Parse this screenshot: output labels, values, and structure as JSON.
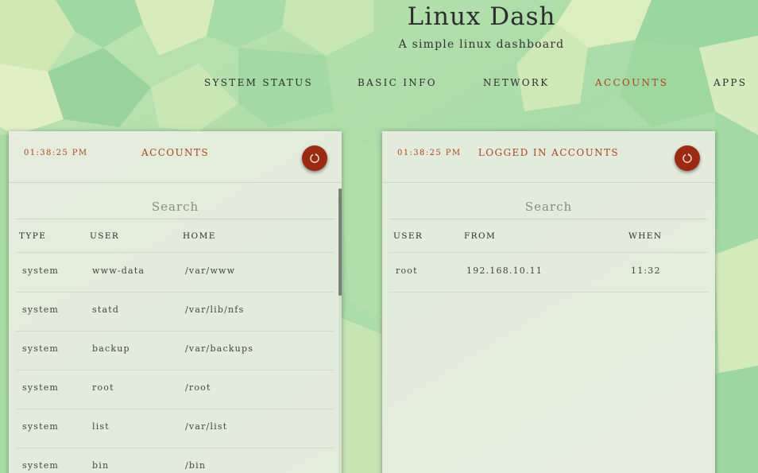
{
  "app": {
    "title": "Linux Dash",
    "subtitle": "A simple linux dashboard"
  },
  "nav": {
    "items": [
      "SYSTEM STATUS",
      "BASIC INFO",
      "NETWORK",
      "ACCOUNTS",
      "APPS"
    ],
    "active": "ACCOUNTS"
  },
  "colors": {
    "accent": "#a8461e",
    "button": "#9b2a12",
    "panel": "#eceee4"
  },
  "accounts_panel": {
    "time": "01:38:25 PM",
    "title": "ACCOUNTS",
    "refresh_icon": "refresh-icon",
    "search_placeholder": "Search",
    "columns": [
      "TYPE",
      "USER",
      "HOME"
    ],
    "rows": [
      [
        "system",
        "www-data",
        "/var/www"
      ],
      [
        "system",
        "statd",
        "/var/lib/nfs"
      ],
      [
        "system",
        "backup",
        "/var/backups"
      ],
      [
        "system",
        "root",
        "/root"
      ],
      [
        "system",
        "list",
        "/var/list"
      ],
      [
        "system",
        "bin",
        "/bin"
      ]
    ]
  },
  "logged_panel": {
    "time": "01:38:25 PM",
    "title": "LOGGED IN ACCOUNTS",
    "refresh_icon": "refresh-icon",
    "search_placeholder": "Search",
    "columns": [
      "USER",
      "FROM",
      "WHEN"
    ],
    "rows": [
      [
        "root",
        "192.168.10.11",
        "11:32"
      ]
    ]
  }
}
